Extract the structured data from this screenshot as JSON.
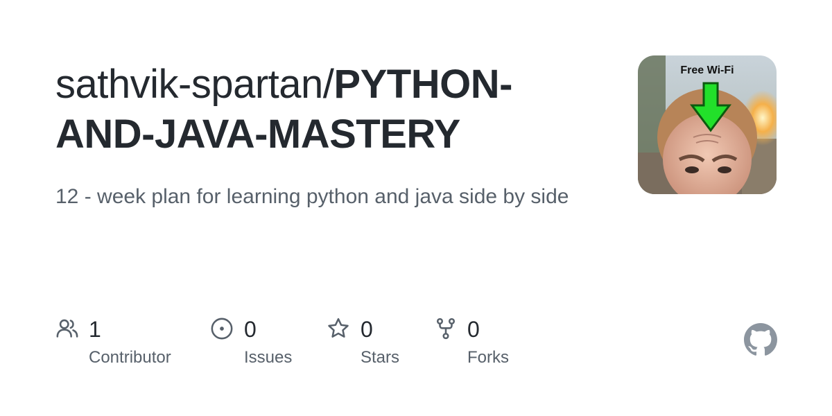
{
  "repo": {
    "owner": "sathvik-spartan/",
    "name": "PYTHON-AND-JAVA-MASTERY",
    "description": "12 - week plan for learning python and java side by side"
  },
  "avatar": {
    "caption": "Free Wi-Fi"
  },
  "stats": {
    "contributors": {
      "count": "1",
      "label": "Contributor",
      "icon": "people-icon"
    },
    "issues": {
      "count": "0",
      "label": "Issues",
      "icon": "issue-opened-icon"
    },
    "stars": {
      "count": "0",
      "label": "Stars",
      "icon": "star-icon"
    },
    "forks": {
      "count": "0",
      "label": "Forks",
      "icon": "repo-forked-icon"
    }
  },
  "colors": {
    "text_primary": "#24292f",
    "text_secondary": "#57606a",
    "icon": "#57606a",
    "logo": "#8c959f"
  }
}
